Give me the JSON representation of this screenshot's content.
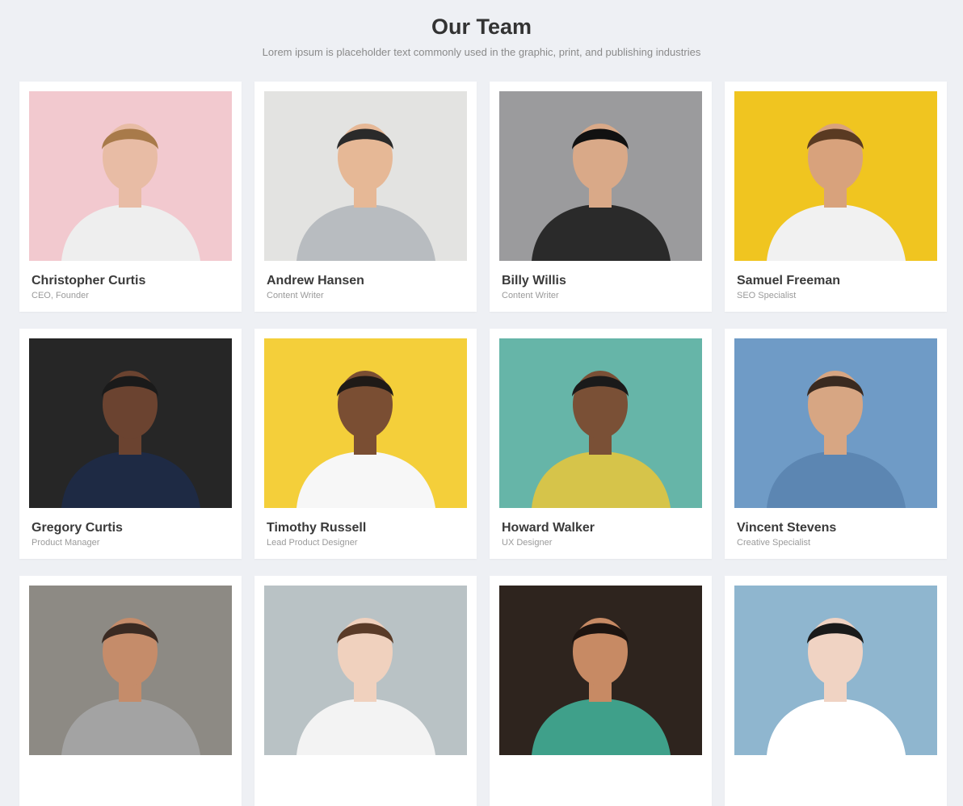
{
  "header": {
    "title": "Our Team",
    "subtitle": "Lorem ipsum is placeholder text commonly used in the graphic, print, and publishing industries"
  },
  "members": [
    {
      "name": "Christopher Curtis",
      "role": "CEO, Founder",
      "bg": "#f2c9cf",
      "skin": "#e8bca5",
      "hair": "#a87a4a",
      "shirt": "#eeeeee",
      "photo_icon": "person-portrait-icon"
    },
    {
      "name": "Andrew Hansen",
      "role": "Content Writer",
      "bg": "#e3e3e1",
      "skin": "#e6b896",
      "hair": "#2a2a2a",
      "shirt": "#b8bcc0",
      "photo_icon": "person-portrait-icon"
    },
    {
      "name": "Billy Willis",
      "role": "Content Writer",
      "bg": "#9b9b9d",
      "skin": "#d9a988",
      "hair": "#111111",
      "shirt": "#2a2a2a",
      "photo_icon": "person-portrait-icon"
    },
    {
      "name": "Samuel Freeman",
      "role": "SEO Specialist",
      "bg": "#f0c520",
      "skin": "#d8a27c",
      "hair": "#5a3a22",
      "shirt": "#f1f1f1",
      "photo_icon": "person-portrait-icon"
    },
    {
      "name": "Gregory Curtis",
      "role": "Product Manager",
      "bg": "#262626",
      "skin": "#6b4330",
      "hair": "#1a1a1a",
      "shirt": "#1e2a44",
      "photo_icon": "person-portrait-icon"
    },
    {
      "name": "Timothy Russell",
      "role": "Lead Product Designer",
      "bg": "#f4cf3a",
      "skin": "#7a4e33",
      "hair": "#1f1a17",
      "shirt": "#f7f7f7",
      "photo_icon": "person-portrait-icon"
    },
    {
      "name": "Howard Walker",
      "role": "UX Designer",
      "bg": "#66b5a8",
      "skin": "#7a5036",
      "hair": "#1a1a1a",
      "shirt": "#d6c44a",
      "photo_icon": "person-portrait-icon"
    },
    {
      "name": "Vincent Stevens",
      "role": "Creative Specialist",
      "bg": "#6f9bc6",
      "skin": "#d7a683",
      "hair": "#3a2a20",
      "shirt": "#5c86b2",
      "photo_icon": "person-portrait-icon"
    },
    {
      "name": "",
      "role": "",
      "bg": "#8d8a84",
      "skin": "#c58c6a",
      "hair": "#3a2a22",
      "shirt": "#a3a3a3",
      "photo_icon": "person-portrait-icon"
    },
    {
      "name": "",
      "role": "",
      "bg": "#b9c2c5",
      "skin": "#f0d1be",
      "hair": "#5a3b28",
      "shirt": "#f3f3f3",
      "photo_icon": "person-portrait-icon"
    },
    {
      "name": "",
      "role": "",
      "bg": "#2e241e",
      "skin": "#c78a64",
      "hair": "#1d1410",
      "shirt": "#3fa08a",
      "photo_icon": "person-portrait-icon"
    },
    {
      "name": "",
      "role": "",
      "bg": "#8fb6cf",
      "skin": "#f0d3c3",
      "hair": "#1a1a1a",
      "shirt": "#ffffff",
      "photo_icon": "person-portrait-icon"
    }
  ]
}
